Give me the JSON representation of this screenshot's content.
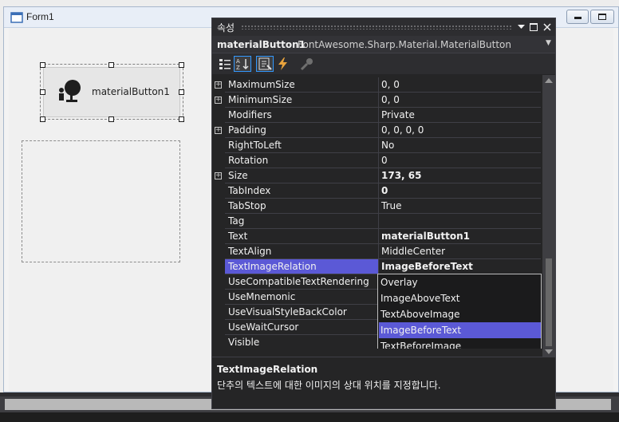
{
  "form": {
    "title": "Form1",
    "button_label": "materialButton1"
  },
  "properties": {
    "window_title": "속성",
    "object_name": "materialButton1",
    "object_type": "FontAwesome.Sharp.Material.MaterialButton",
    "rows": [
      {
        "name": "MaximumSize",
        "value": "0, 0",
        "expandable": true,
        "bold": false
      },
      {
        "name": "MinimumSize",
        "value": "0, 0",
        "expandable": true,
        "bold": false
      },
      {
        "name": "Modifiers",
        "value": "Private",
        "expandable": false,
        "bold": false
      },
      {
        "name": "Padding",
        "value": "0, 0, 0, 0",
        "expandable": true,
        "bold": false
      },
      {
        "name": "RightToLeft",
        "value": "No",
        "expandable": false,
        "bold": false
      },
      {
        "name": "Rotation",
        "value": "0",
        "expandable": false,
        "bold": false
      },
      {
        "name": "Size",
        "value": "173, 65",
        "expandable": true,
        "bold": true
      },
      {
        "name": "TabIndex",
        "value": "0",
        "expandable": false,
        "bold": true
      },
      {
        "name": "TabStop",
        "value": "True",
        "expandable": false,
        "bold": false
      },
      {
        "name": "Tag",
        "value": "",
        "expandable": false,
        "bold": false
      },
      {
        "name": "Text",
        "value": "materialButton1",
        "expandable": false,
        "bold": true
      },
      {
        "name": "TextAlign",
        "value": "MiddleCenter",
        "expandable": false,
        "bold": false
      },
      {
        "name": "TextImageRelation",
        "value": "ImageBeforeText",
        "expandable": false,
        "bold": true,
        "selected": true
      },
      {
        "name": "UseCompatibleTextRendering",
        "value": "",
        "expandable": false,
        "bold": false
      },
      {
        "name": "UseMnemonic",
        "value": "",
        "expandable": false,
        "bold": false
      },
      {
        "name": "UseVisualStyleBackColor",
        "value": "",
        "expandable": false,
        "bold": false
      },
      {
        "name": "UseWaitCursor",
        "value": "",
        "expandable": false,
        "bold": false
      },
      {
        "name": "Visible",
        "value": "",
        "expandable": false,
        "bold": false
      }
    ],
    "dropdown_options": [
      "Overlay",
      "ImageAboveText",
      "TextAboveImage",
      "ImageBeforeText",
      "TextBeforeImage"
    ],
    "dropdown_selected": "ImageBeforeText",
    "description_title": "TextImageRelation",
    "description_text": "단추의 텍스트에 대한 이미지의 상대 위치를 지정합니다."
  },
  "colors": {
    "selection": "#5b59d6",
    "panel_bg": "#252526",
    "accent": "#3399ff"
  }
}
